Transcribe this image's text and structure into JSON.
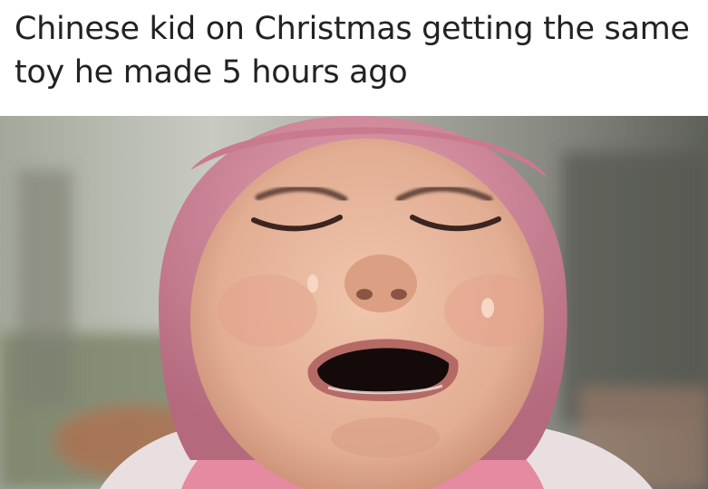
{
  "caption": {
    "text": "Chinese kid on Christmas getting the same toy he made 5 hours ago"
  },
  "photo": {
    "subject_icon": "crying-child-photo",
    "colors": {
      "hat": "#d98fa2",
      "hat_shadow": "#b86f82",
      "skin": "#e8b9a0",
      "skin_shadow": "#c98f74",
      "mouth": "#1a0e0e",
      "lips": "#b56a66",
      "tear": "#f2c9b6",
      "scarf": "#e07a92",
      "background_left": "#8f9585",
      "background_right": "#6d6f66"
    }
  }
}
